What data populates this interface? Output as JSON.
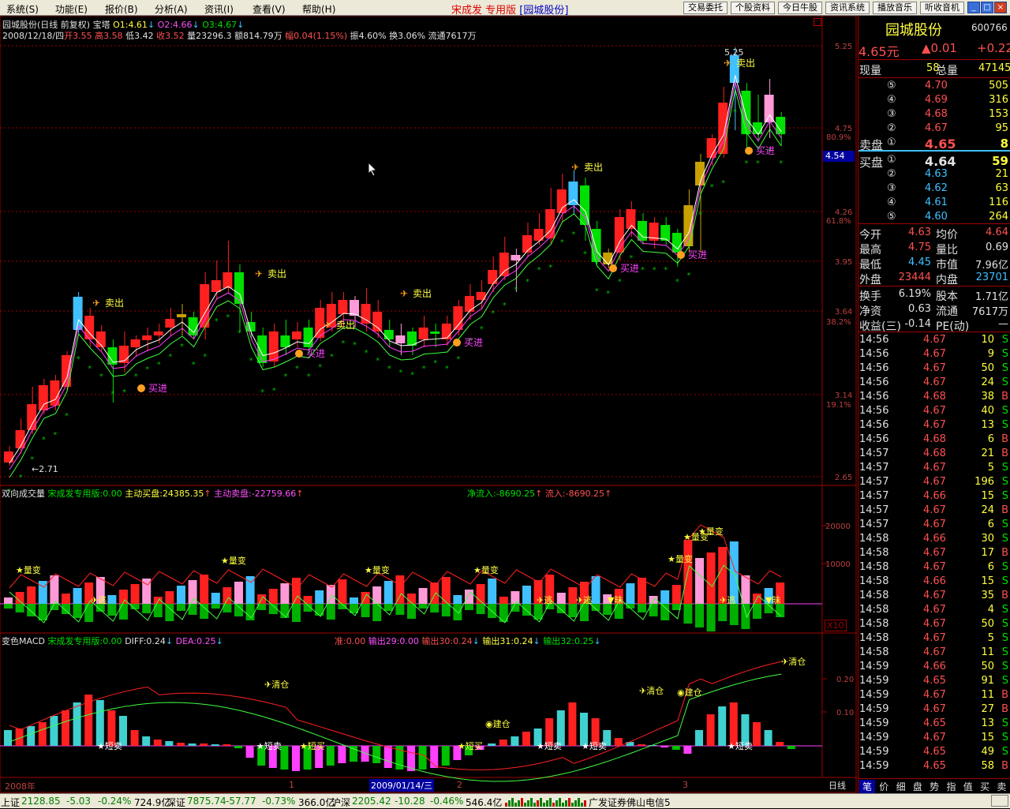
{
  "menu": [
    "系统(S)",
    "功能(E)",
    "报价(B)",
    "分析(A)",
    "资讯(I)",
    "查看(V)",
    "帮助(H)"
  ],
  "app_title": "宋成发 专用版",
  "app_stock": "[园城股份]",
  "toolbar": [
    "交易委托",
    "个股资料",
    "今日牛股",
    "资讯系统",
    "播放音乐",
    "听收音机"
  ],
  "header": {
    "line1": "园城股份(日线 前复权) 宝塔",
    "o1": "O1:4.61",
    "o2": "O2:4.66",
    "o3": "O3:4.67",
    "date": "2008/12/18/四",
    "open": "开3.55",
    "high": "高3.58",
    "low": "低3.42",
    "close": "收3.52",
    "vol": "量23296.3",
    "amt": "额814.79万",
    "chg": "幅0.04(1.15%)",
    "amp": "振4.60%",
    "turn": "换3.06%",
    "float": "流通7617万"
  },
  "price_axis": [
    "5.25",
    "4.75",
    "4.26",
    "3.95",
    "3.64",
    "3.14",
    "2.65"
  ],
  "pct_axis": [
    "80.9%",
    "61.8%",
    "38.2%",
    "19.1%"
  ],
  "cursor_price": "4.54",
  "annotations": {
    "hi": "5.25",
    "lo": "2.71",
    "sell": "卖出",
    "buy": "买进",
    "liangbian": "量变",
    "tao": "逃",
    "zhang": "昧",
    "qingcang": "清仓",
    "jiancang": "建仓",
    "duanmai": "短卖",
    "duanmaii": "短买"
  },
  "vol_panel": {
    "title": "双向成交量",
    "l1": "宋成发专用版:0.00",
    "l2": "主动买盘:24385.35",
    "l3": "主动卖盘:-22759.66",
    "l4": "净流入:-8690.25",
    "l5": "流入:-8690.25",
    "axis": [
      "20000",
      "10000"
    ],
    "x10": "X10"
  },
  "macd_panel": {
    "title": "变色MACD",
    "l1": "宋成发专用版:0.00",
    "diff": "DIFF:0.24",
    "dea": "DEA:0.25",
    "l4": "准:0.00",
    "l5": "输出29:0.00",
    "l6": "输出30:0.24",
    "l7": "输出31:0.24",
    "l8": "输出32:0.25",
    "axis": [
      "0.20",
      "0.10"
    ]
  },
  "xaxis": {
    "y2008": "2008年",
    "m1": "1",
    "date": "2009/01/14/三",
    "m2": "2",
    "m3": "3",
    "period": "日线"
  },
  "stock": {
    "name": "园城股份",
    "code": "600766",
    "price": "4.65元",
    "change": "▲0.01",
    "change_pct": "+0.22"
  },
  "volume": {
    "now_label": "现量",
    "now": "58",
    "total_label": "总量",
    "total": "47145"
  },
  "asks": [
    {
      "lv": "⑤",
      "p": "4.70",
      "v": "505"
    },
    {
      "lv": "④",
      "p": "4.69",
      "v": "316"
    },
    {
      "lv": "③",
      "p": "4.68",
      "v": "153"
    },
    {
      "lv": "②",
      "p": "4.67",
      "v": "95"
    },
    {
      "lv": "①",
      "p": "4.65",
      "v": "8",
      "label": "卖盘"
    }
  ],
  "bids": [
    {
      "lv": "①",
      "p": "4.64",
      "v": "59",
      "label": "买盘"
    },
    {
      "lv": "②",
      "p": "4.63",
      "v": "21"
    },
    {
      "lv": "③",
      "p": "4.62",
      "v": "63"
    },
    {
      "lv": "④",
      "p": "4.61",
      "v": "116"
    },
    {
      "lv": "⑤",
      "p": "4.60",
      "v": "264"
    }
  ],
  "stats": [
    [
      "今开",
      "4.63",
      "均价",
      "4.64"
    ],
    [
      "最高",
      "4.75",
      "量比",
      "0.69"
    ],
    [
      "最低",
      "4.45",
      "市值",
      "7.96亿"
    ],
    [
      "外盘",
      "23444",
      "内盘",
      "23701"
    ],
    [
      "换手",
      "6.19%",
      "股本",
      "1.71亿"
    ],
    [
      "净资",
      "0.63",
      "流通",
      "7617万"
    ],
    [
      "收益(三)",
      "-0.14",
      "PE(动)",
      "—"
    ]
  ],
  "ticks": [
    [
      "14:56",
      "4.67",
      "10",
      "S"
    ],
    [
      "14:56",
      "4.67",
      "9",
      "S"
    ],
    [
      "14:56",
      "4.67",
      "50",
      "S"
    ],
    [
      "14:56",
      "4.67",
      "24",
      "S"
    ],
    [
      "14:56",
      "4.68",
      "38",
      "B"
    ],
    [
      "14:56",
      "4.67",
      "40",
      "S"
    ],
    [
      "14:56",
      "4.67",
      "13",
      "S"
    ],
    [
      "14:56",
      "4.68",
      "6",
      "B"
    ],
    [
      "14:57",
      "4.68",
      "21",
      "B"
    ],
    [
      "14:57",
      "4.67",
      "5",
      "S"
    ],
    [
      "14:57",
      "4.67",
      "196",
      "S"
    ],
    [
      "14:57",
      "4.66",
      "15",
      "S"
    ],
    [
      "14:57",
      "4.67",
      "24",
      "B"
    ],
    [
      "14:57",
      "4.67",
      "6",
      "S"
    ],
    [
      "14:58",
      "4.66",
      "30",
      "S"
    ],
    [
      "14:58",
      "4.67",
      "17",
      "B"
    ],
    [
      "14:58",
      "4.67",
      "6",
      "S"
    ],
    [
      "14:58",
      "4.66",
      "15",
      "S"
    ],
    [
      "14:58",
      "4.67",
      "35",
      "B"
    ],
    [
      "14:58",
      "4.67",
      "4",
      "S"
    ],
    [
      "14:58",
      "4.67",
      "50",
      "S"
    ],
    [
      "14:58",
      "4.67",
      "5",
      "S"
    ],
    [
      "14:58",
      "4.67",
      "11",
      "S"
    ],
    [
      "14:59",
      "4.66",
      "50",
      "S"
    ],
    [
      "14:59",
      "4.65",
      "91",
      "S"
    ],
    [
      "14:59",
      "4.67",
      "11",
      "B"
    ],
    [
      "14:59",
      "4.67",
      "27",
      "B"
    ],
    [
      "14:59",
      "4.65",
      "13",
      "S"
    ],
    [
      "14:59",
      "4.67",
      "15",
      "S"
    ],
    [
      "14:59",
      "4.65",
      "49",
      "S"
    ],
    [
      "14:59",
      "4.65",
      "58",
      "B"
    ]
  ],
  "side_tabs": [
    "笔",
    "价",
    "细",
    "盘",
    "势",
    "指",
    "值",
    "买",
    "卖"
  ],
  "status": {
    "sh_label": "上证",
    "sh": "2128.85",
    "sh_chg": "-5.03",
    "sh_pct": "-0.24%",
    "sh_amt": "724.9亿",
    "sz_label": "深证",
    "sz": "7875.74",
    "sz_chg": "-57.77",
    "sz_pct": "-0.73%",
    "sz_amt": "366.0亿",
    "hs_label": "沪深",
    "hs": "2205.42",
    "hs_chg": "-10.28",
    "hs_pct": "-0.46%",
    "hs_amt": "546.4亿",
    "broker": "广发证券佛山电信5"
  },
  "colors": {
    "up": "#ff2020",
    "down": "#00e000",
    "cyan": "#40c0ff",
    "pink": "#ff9ad8",
    "gold": "#c8a000",
    "grid": "#a00000"
  }
}
